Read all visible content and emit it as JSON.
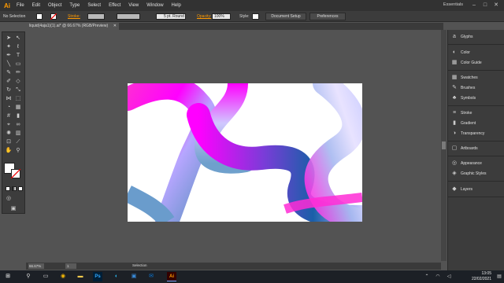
{
  "app": {
    "logo": "Ai"
  },
  "menu": [
    "File",
    "Edit",
    "Object",
    "Type",
    "Select",
    "Effect",
    "View",
    "Window",
    "Help"
  ],
  "workspace": "Essentials",
  "window_controls": {
    "minimize": "–",
    "maximize": "□",
    "close": "✕"
  },
  "control_bar": {
    "selection_label": "No Selection",
    "stroke_label": "Stroke:",
    "brush_label": "5 pt. Round",
    "opacity_label": "Opacity:",
    "opacity_value": "100%",
    "style_label": "Style:",
    "document_setup": "Document Setup",
    "preferences": "Preferences"
  },
  "document_tab": {
    "title": "liquid(4aja1)(1).ai* @ 66.67% (RGB/Preview)",
    "close": "✕"
  },
  "status_bar": {
    "zoom": "66.67%",
    "page": "1",
    "tool": "Selection"
  },
  "panels": [
    {
      "label": "Glyphs",
      "icon": "glyphs-icon",
      "glyph": "a"
    },
    {
      "label": "Color",
      "icon": "color-icon",
      "glyph": "◐"
    },
    {
      "label": "Color Guide",
      "icon": "color-guide-icon",
      "glyph": "▦"
    },
    {
      "label": "Swatches",
      "icon": "swatches-icon",
      "glyph": "▦"
    },
    {
      "label": "Brushes",
      "icon": "brushes-icon",
      "glyph": "✎"
    },
    {
      "label": "Symbols",
      "icon": "symbols-icon",
      "glyph": "♣"
    },
    {
      "label": "Stroke",
      "icon": "stroke-icon",
      "glyph": "≡"
    },
    {
      "label": "Gradient",
      "icon": "gradient-icon",
      "glyph": "▮"
    },
    {
      "label": "Transparency",
      "icon": "transparency-icon",
      "glyph": "◑"
    },
    {
      "label": "Artboards",
      "icon": "artboards-icon",
      "glyph": "▢"
    },
    {
      "label": "Appearance",
      "icon": "appearance-icon",
      "glyph": "◎"
    },
    {
      "label": "Graphic Styles",
      "icon": "graphic-styles-icon",
      "glyph": "◈"
    },
    {
      "label": "Layers",
      "icon": "layers-icon",
      "glyph": "◆"
    }
  ],
  "taskbar": {
    "time": "13:05",
    "date": "22/02/2021"
  },
  "colors": {
    "accent": "#ff9a00",
    "magenta": "#ff00ff",
    "blue": "#1a5fa8",
    "lavender": "#c6c8ff"
  }
}
